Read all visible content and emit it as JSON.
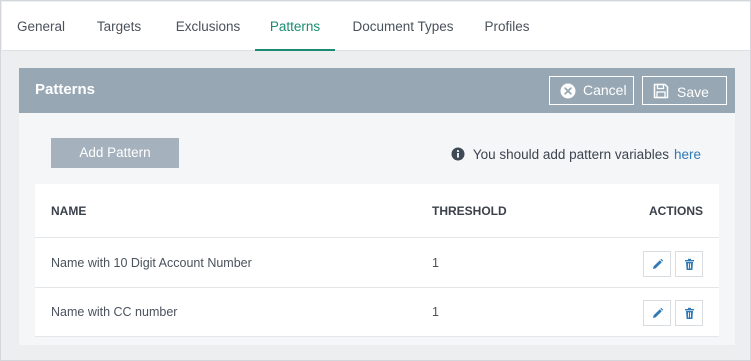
{
  "tabs": [
    "General",
    "Targets",
    "Exclusions",
    "Patterns",
    "Document Types",
    "Profiles"
  ],
  "active_tab": "Patterns",
  "panel": {
    "title": "Patterns",
    "cancel_label": "Cancel",
    "save_label": "Save"
  },
  "add_pattern_label": "Add Pattern",
  "hint": {
    "text": "You should add pattern variables",
    "link": "here"
  },
  "table": {
    "headers": {
      "name": "NAME",
      "threshold": "THRESHOLD",
      "actions": "ACTIONS"
    },
    "rows": [
      {
        "name": "Name with 10 Digit Account Number",
        "threshold": "1"
      },
      {
        "name": "Name with CC number",
        "threshold": "1"
      }
    ]
  },
  "colors": {
    "accent": "#1a8b73",
    "header_bg": "#97a7b4",
    "link": "#2e7ab8",
    "action_icon": "#2e7ab8"
  },
  "icons": {
    "cancel": "close-circle-icon",
    "save": "save-icon",
    "info": "info-circle-icon",
    "edit": "pencil-icon",
    "delete": "trash-icon"
  }
}
